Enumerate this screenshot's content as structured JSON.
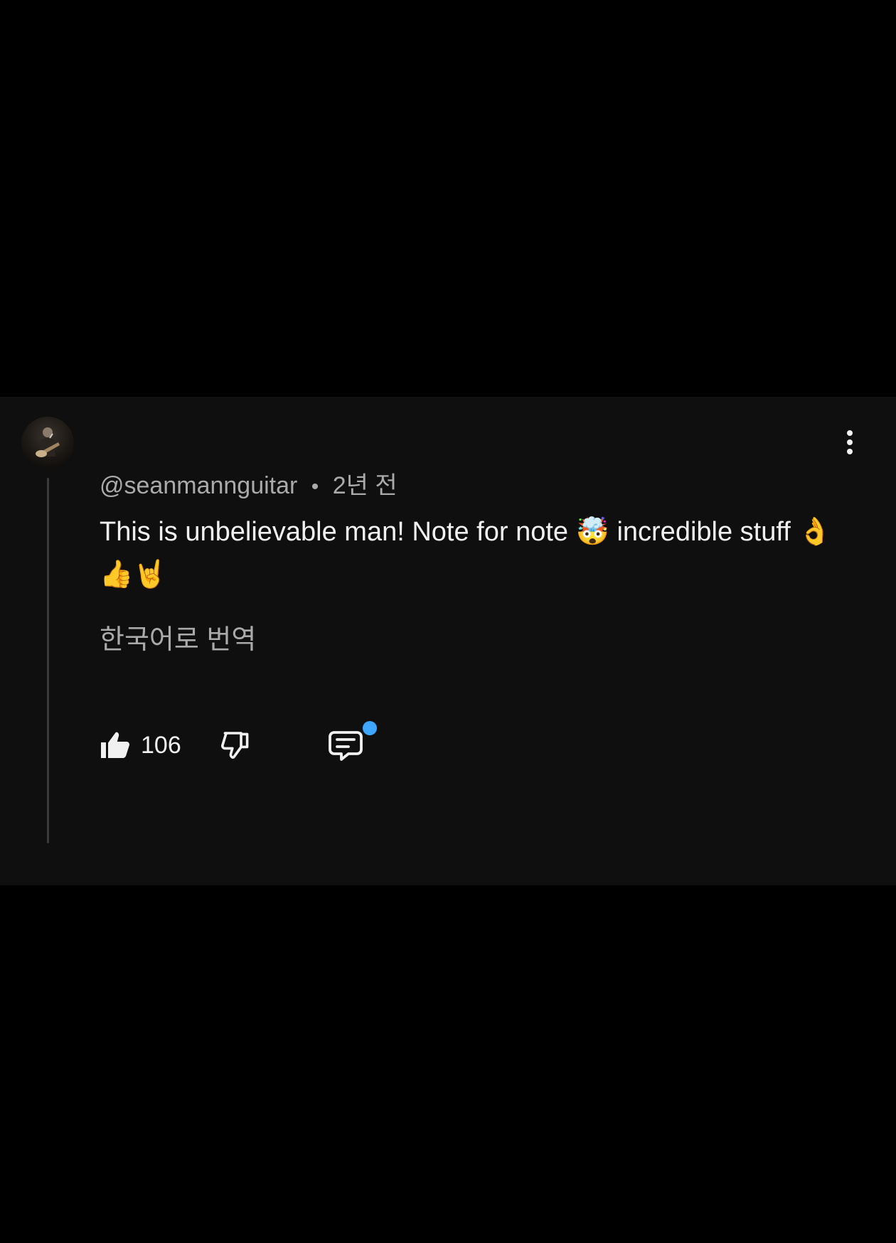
{
  "comment": {
    "handle": "@seanmannguitar",
    "separator": "•",
    "time_ago": "2년 전",
    "text": "This is unbelievable man! Note for note 🤯 incredible stuff 👌👍🤘",
    "translate_label": "한국어로 번역",
    "like_count": "106",
    "avatar_icon": "guitarist-avatar",
    "more_icon": "more-vert-icon"
  },
  "colors": {
    "page_background": "#000000",
    "card_background": "#0f0f0f",
    "primary_text": "#f1f1f1",
    "secondary_text": "#aaaaaa",
    "thread_line": "#3a3a3a",
    "unread_dot": "#3ea6ff"
  },
  "icons": {
    "like": "thumb-up-filled-icon",
    "dislike": "thumb-down-outline-icon",
    "reply": "reply-comment-icon"
  }
}
